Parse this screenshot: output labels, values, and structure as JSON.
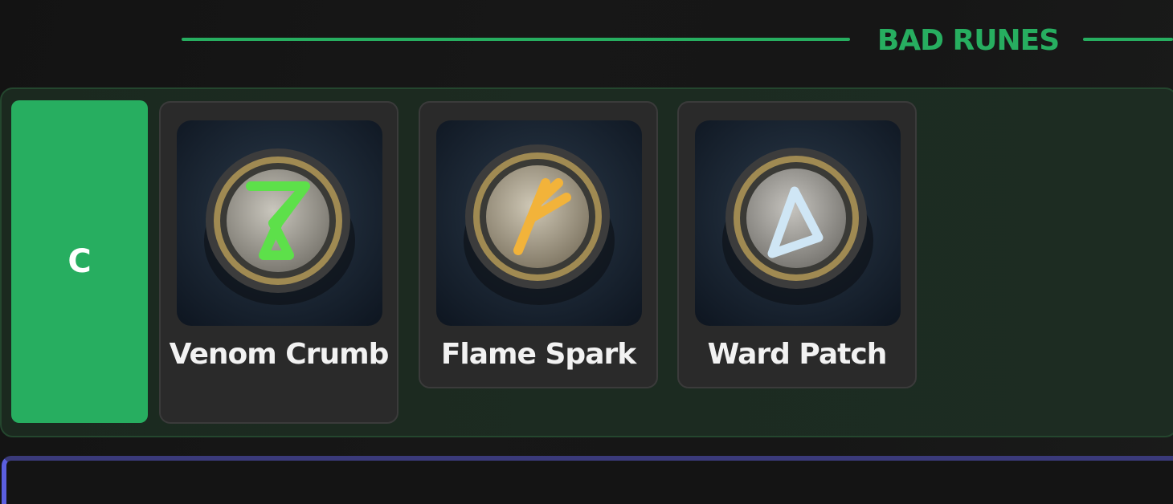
{
  "colors": {
    "accent_green": "#27ae60",
    "tier_c_fill": "#27ae60",
    "next_panel_accent": "#5b5fe0"
  },
  "section": {
    "title": "BAD RUNES"
  },
  "tier": {
    "letter": "C",
    "runes": [
      {
        "name": "Venom Crumb",
        "icon": "venom-rune-icon",
        "glow": "#5de04a"
      },
      {
        "name": "Flame Spark",
        "icon": "flame-rune-icon",
        "glow": "#f2b33a"
      },
      {
        "name": "Ward Patch",
        "icon": "ward-rune-icon",
        "glow": "#cfe6f5"
      }
    ]
  }
}
